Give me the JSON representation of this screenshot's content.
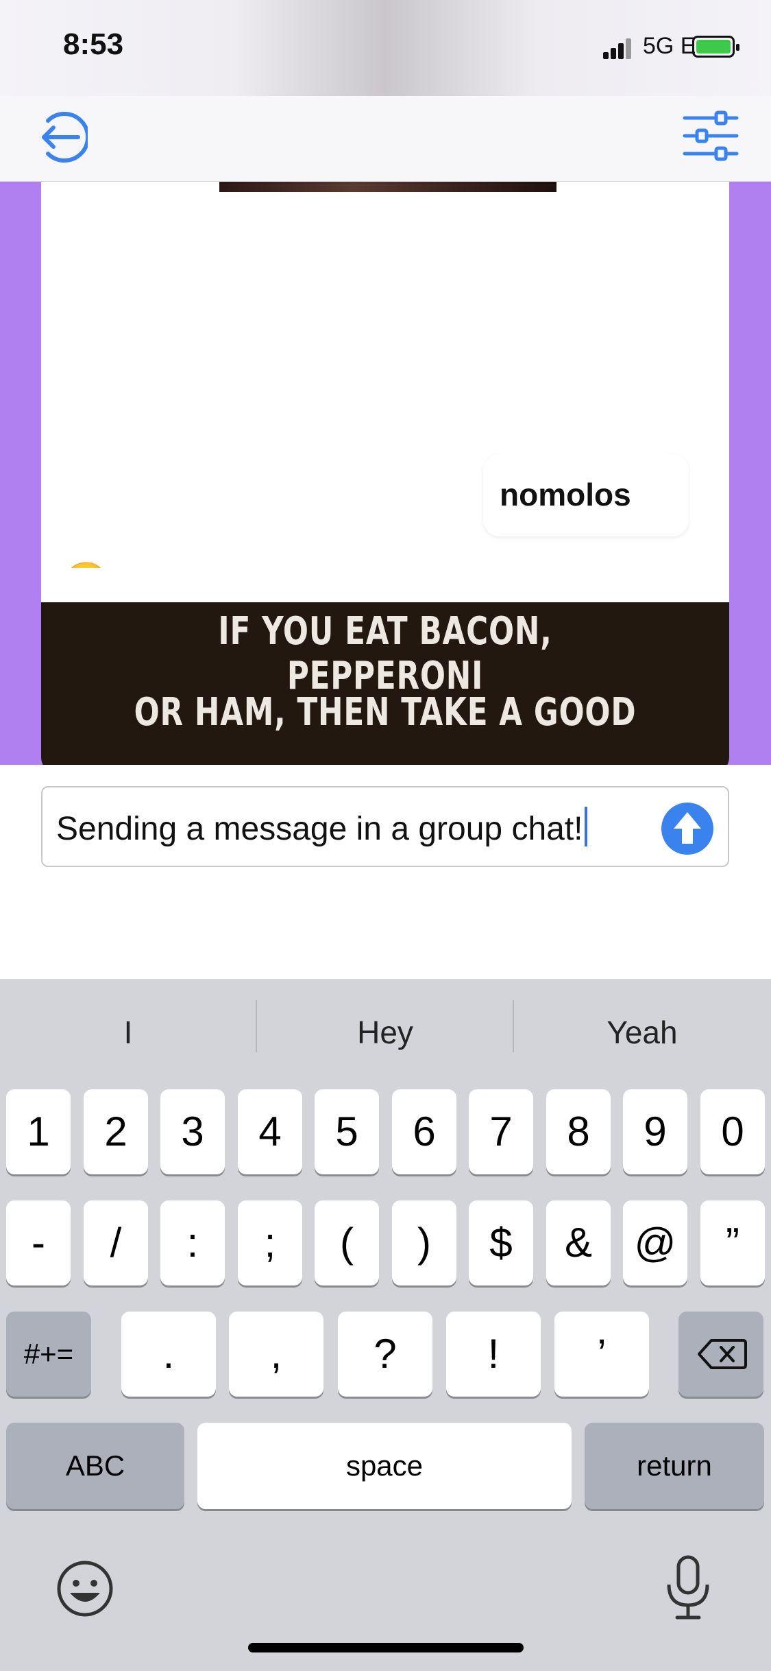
{
  "status_bar": {
    "time": "8:53",
    "network": "5G E"
  },
  "nav": {
    "back_icon": "exit-arrow-icon",
    "filter_icon": "sliders-icon"
  },
  "chat": {
    "message1": {
      "emoji": "😋",
      "username": "nomolos"
    },
    "message2": {
      "image_text_line1": "IF YOU EAT BACON, PEPPERONI",
      "image_text_line2": "OR HAM, THEN TAKE A GOOD"
    }
  },
  "composer": {
    "value": "Sending a message in a group chat!",
    "send_icon": "arrow-up-icon"
  },
  "keyboard": {
    "suggestions": [
      "I",
      "Hey",
      "Yeah"
    ],
    "row1": [
      "1",
      "2",
      "3",
      "4",
      "5",
      "6",
      "7",
      "8",
      "9",
      "0"
    ],
    "row2": [
      "-",
      "/",
      ":",
      ";",
      "(",
      ")",
      "$",
      "&",
      "@",
      "”"
    ],
    "row3": {
      "mode": "#+=",
      "keys": [
        ".",
        ",",
        "?",
        "!",
        "’"
      ]
    },
    "row4": {
      "abc": "ABC",
      "space": "space",
      "return": "return"
    },
    "emoji_icon": "smiley-icon",
    "mic_icon": "microphone-icon",
    "delete_icon": "backspace-icon"
  },
  "colors": {
    "chat_bg": "#b07ff0",
    "accent": "#3a82ee"
  }
}
